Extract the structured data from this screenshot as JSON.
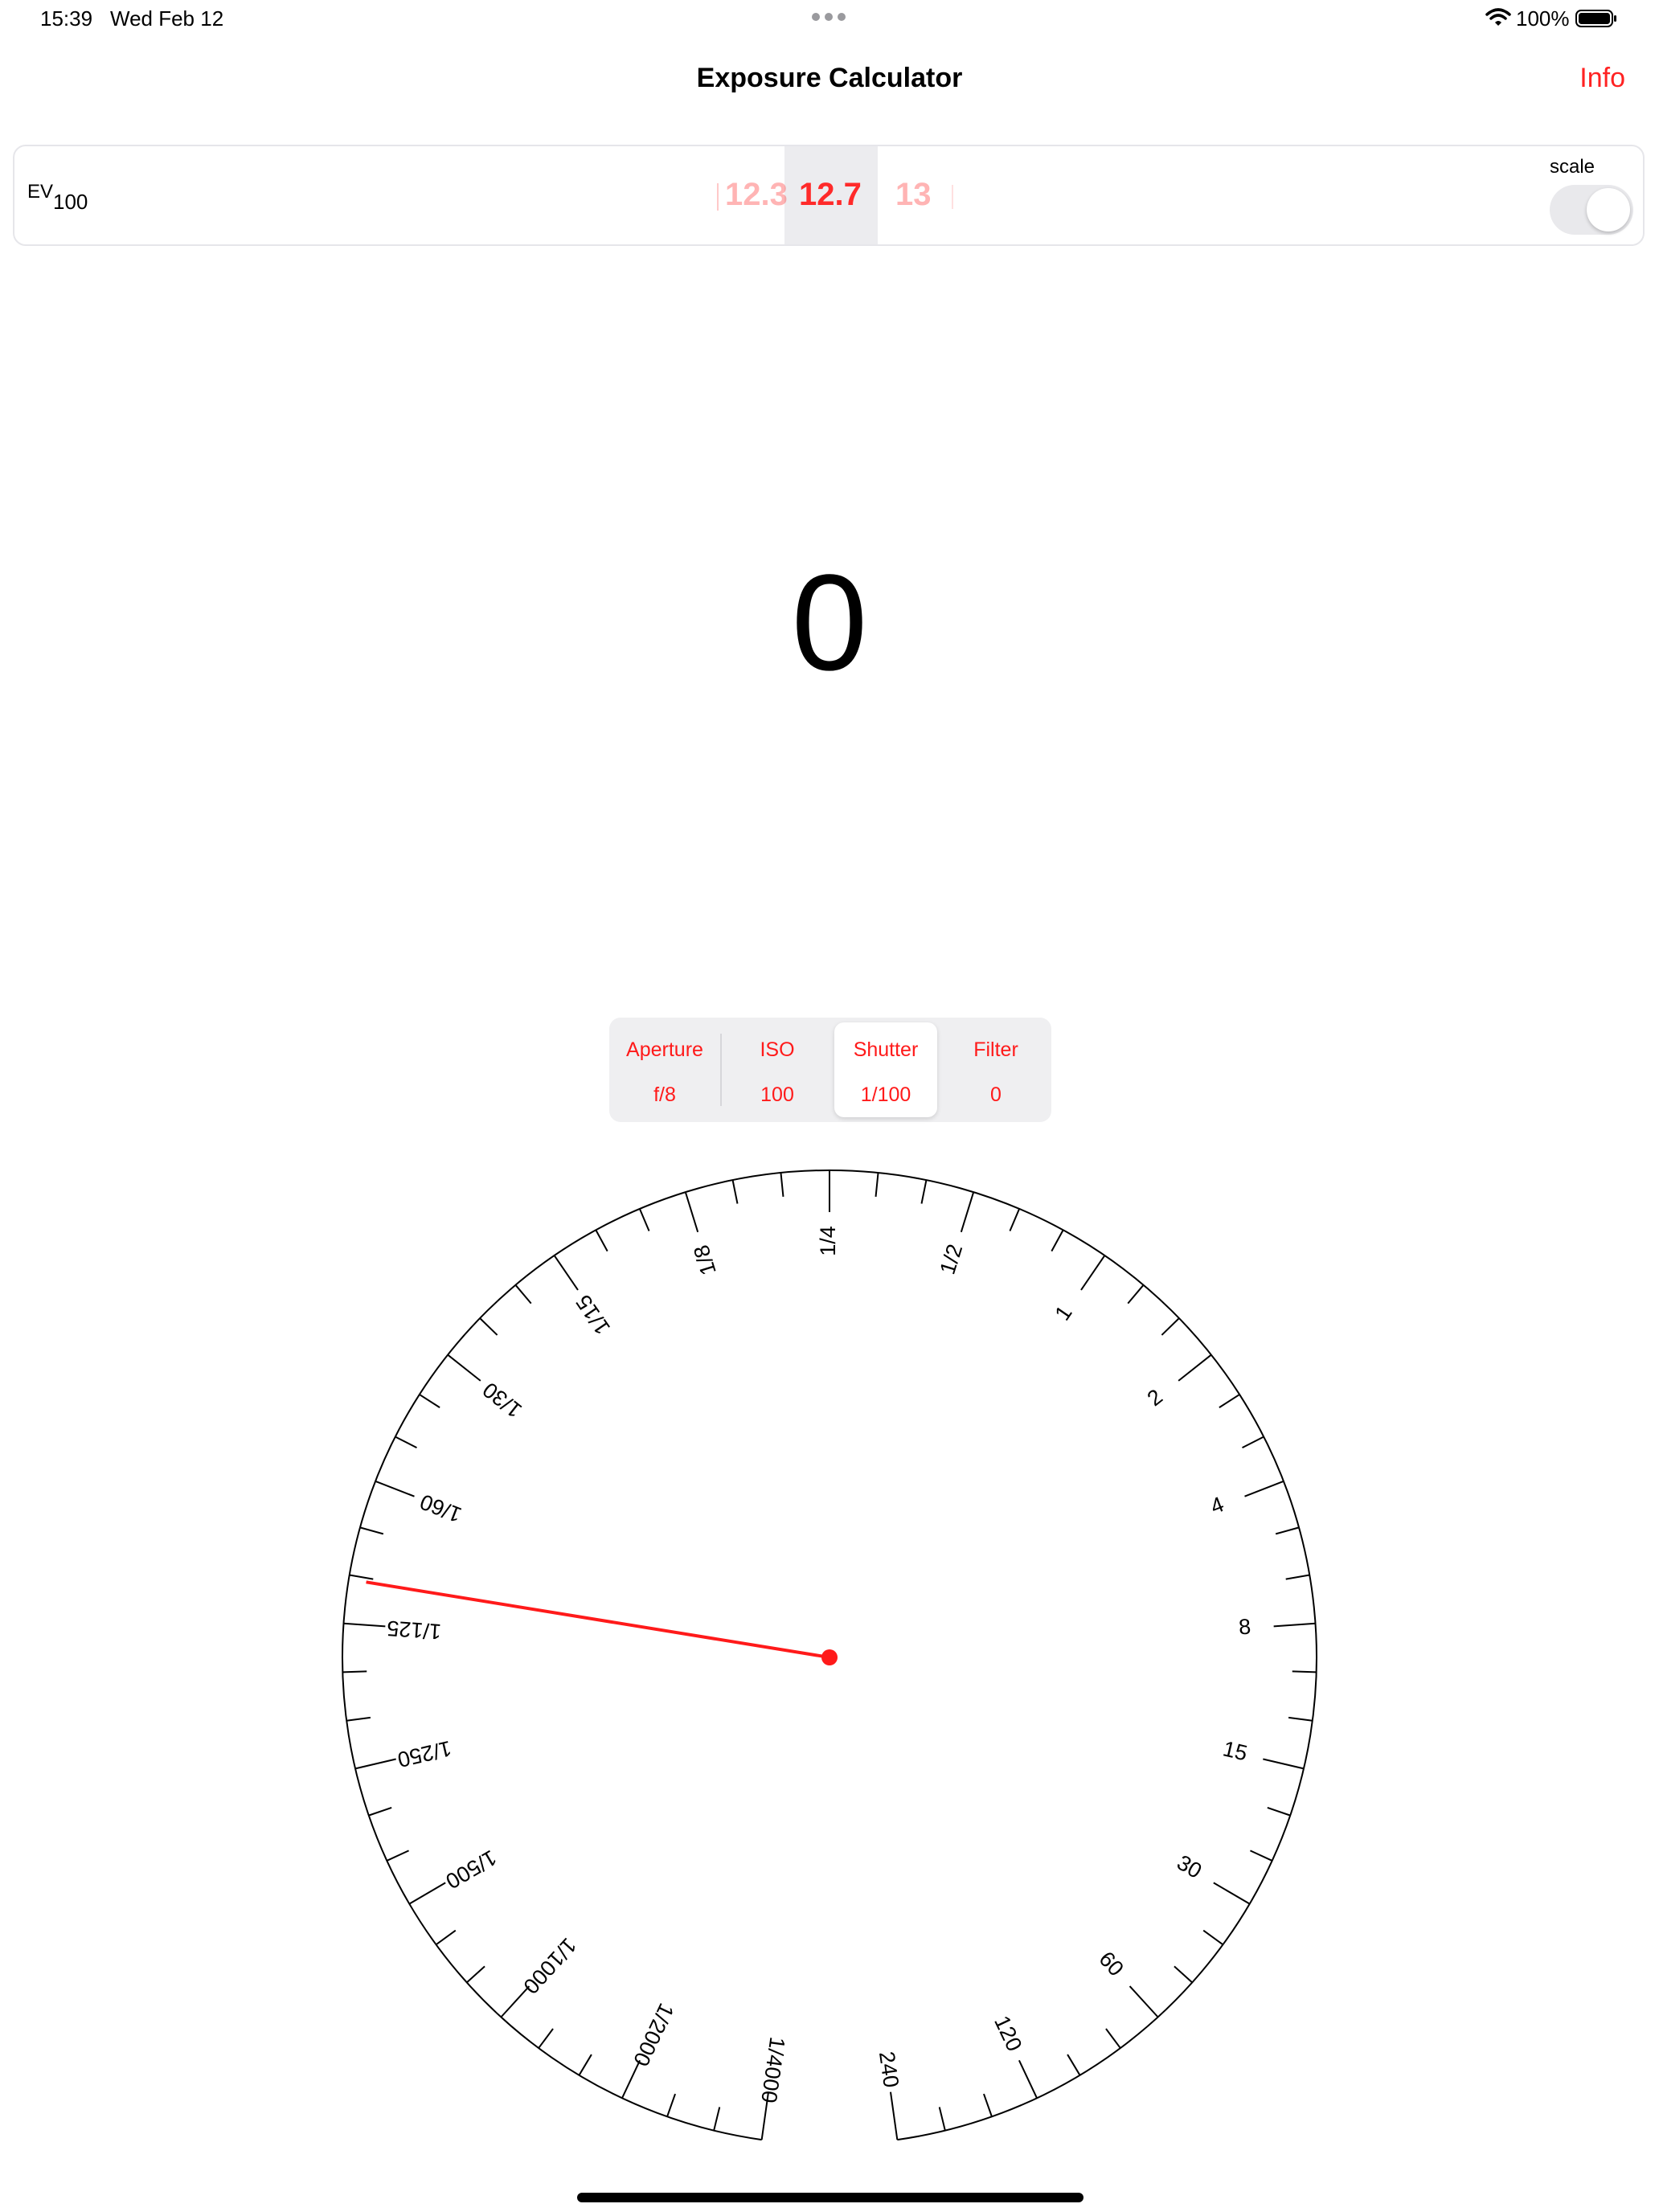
{
  "status_bar": {
    "time": "15:39",
    "date": "Wed Feb 12",
    "battery": "100%"
  },
  "nav": {
    "title": "Exposure Calculator",
    "info_label": "Info"
  },
  "ev": {
    "label_main": "EV",
    "label_sub": "100",
    "values": [
      "12.3",
      "12.7",
      "13"
    ],
    "selected": "12.7",
    "scale_label": "scale",
    "scale_on": false
  },
  "result": {
    "value": "0"
  },
  "segments": [
    {
      "label": "Aperture",
      "value": "f/8"
    },
    {
      "label": "ISO",
      "value": "100"
    },
    {
      "label": "Shutter",
      "value": "1/100",
      "selected": true
    },
    {
      "label": "Filter",
      "value": "0"
    }
  ],
  "dial": {
    "scale_labels": [
      "1/4000",
      "1/2000",
      "1/1000",
      "1/500",
      "1/250",
      "1/125",
      "1/60",
      "1/30",
      "1/15",
      "1/8",
      "1/4",
      "1/2",
      "1",
      "2",
      "4",
      "8",
      "15",
      "30",
      "60",
      "120",
      "240"
    ],
    "current_value": "1/100",
    "accent_color": "#ff1a1a"
  }
}
